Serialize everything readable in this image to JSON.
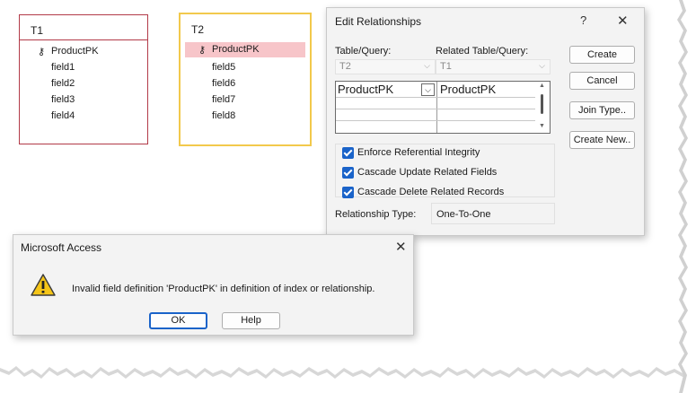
{
  "tables": [
    {
      "name": "T1",
      "key_field": "ProductPK",
      "fields": [
        "field1",
        "field2",
        "field3",
        "field4"
      ]
    },
    {
      "name": "T2",
      "key_field": "ProductPK",
      "fields": [
        "field5",
        "field6",
        "field7",
        "field8"
      ]
    }
  ],
  "edit_relationships": {
    "title": "Edit Relationships",
    "help_glyph": "?",
    "close_glyph": "✕",
    "table_query_label": "Table/Query:",
    "related_label": "Related Table/Query:",
    "table_value": "T2",
    "related_value": "T1",
    "grid_row": {
      "left": "ProductPK",
      "right": "ProductPK"
    },
    "buttons": {
      "create": "Create",
      "cancel": "Cancel",
      "join_type": "Join Type..",
      "create_new": "Create New.."
    },
    "checks": {
      "enforce": "Enforce Referential Integrity",
      "cascade_update": "Cascade Update Related Fields",
      "cascade_delete": "Cascade Delete Related Records"
    },
    "relationship_type_label": "Relationship Type:",
    "relationship_type_value": "One-To-One"
  },
  "message_box": {
    "title": "Microsoft Access",
    "close_glyph": "✕",
    "text": "Invalid field definition 'ProductPK' in definition of index or relationship.",
    "ok": "OK",
    "help": "Help"
  }
}
